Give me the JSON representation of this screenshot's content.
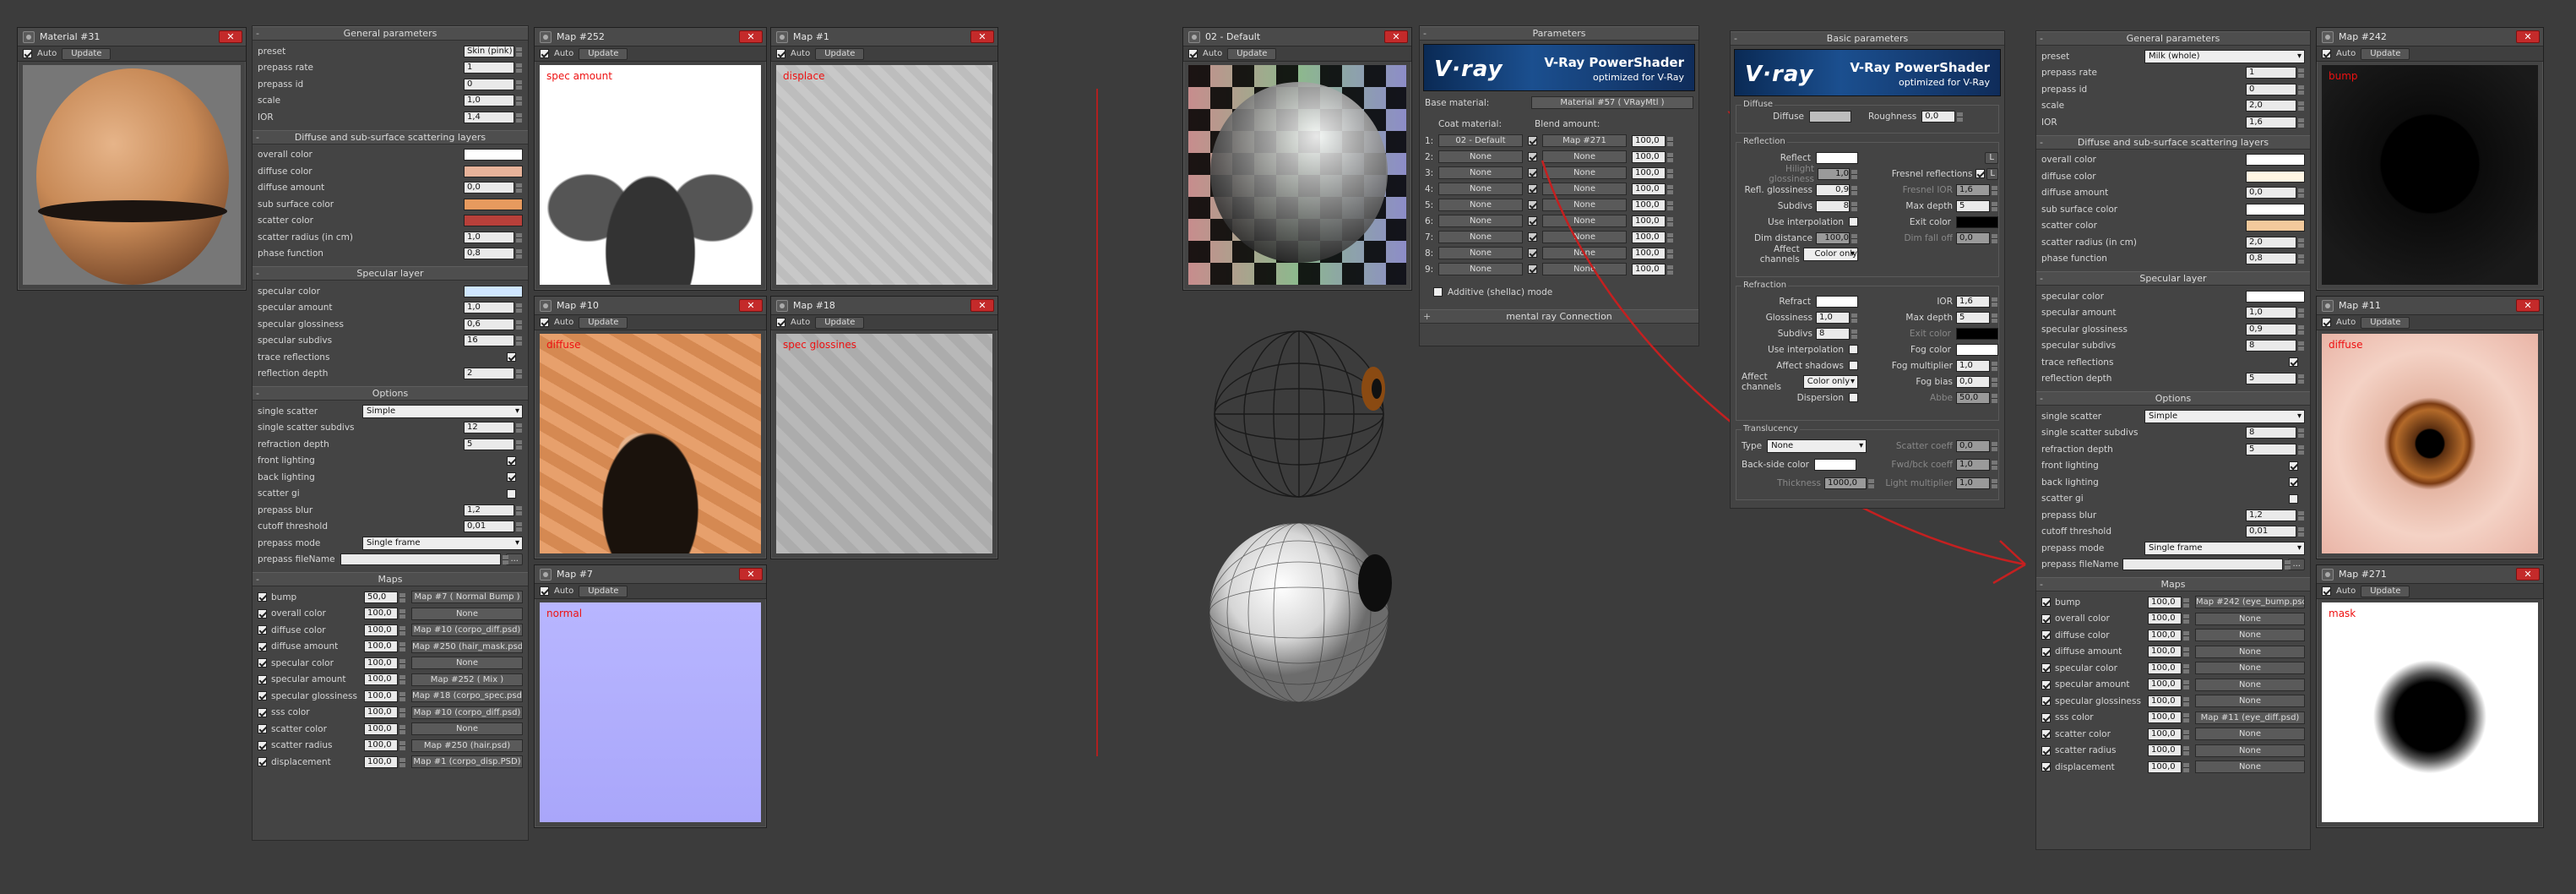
{
  "colors": {
    "accent_red": "#e11111",
    "vray_blue": "#1b4f8f",
    "bg": "#3c3c3c"
  },
  "left": {
    "material_win": {
      "title": "Material #31",
      "auto": "Auto",
      "update": "Update"
    },
    "general": {
      "header": "General parameters",
      "rows": [
        {
          "label": "preset",
          "value": "Skin (pink)"
        },
        {
          "label": "prepass rate",
          "value": "1"
        },
        {
          "label": "prepass id",
          "value": "0"
        },
        {
          "label": "scale",
          "value": "1,0"
        },
        {
          "label": "IOR",
          "value": "1,4"
        }
      ]
    },
    "diffuse": {
      "header": "Diffuse and sub-surface scattering layers",
      "rows": [
        {
          "label": "overall color",
          "color": "#ffffff"
        },
        {
          "label": "diffuse color",
          "color": "#e8b39a"
        },
        {
          "label": "diffuse amount",
          "value": "0,0"
        },
        {
          "label": "sub surface color",
          "color": "#e79a5e"
        },
        {
          "label": "scatter color",
          "color": "#b8403a"
        },
        {
          "label": "scatter radius (in cm)",
          "value": "1,0"
        },
        {
          "label": "phase function",
          "value": "0,8"
        }
      ]
    },
    "specular": {
      "header": "Specular layer",
      "rows": [
        {
          "label": "specular color",
          "color": "#cfe6ff"
        },
        {
          "label": "specular amount",
          "value": "1,0"
        },
        {
          "label": "specular glossiness",
          "value": "0,6"
        },
        {
          "label": "specular subdivs",
          "value": "16"
        },
        {
          "label": "trace reflections",
          "check": true
        },
        {
          "label": "reflection depth",
          "value": "2"
        }
      ]
    },
    "options": {
      "header": "Options",
      "rows": [
        {
          "label": "single scatter",
          "dropdown": "Simple"
        },
        {
          "label": "single scatter subdivs",
          "value": "12"
        },
        {
          "label": "refraction depth",
          "value": "5"
        },
        {
          "label": "front lighting",
          "check": true
        },
        {
          "label": "back lighting",
          "check": true
        },
        {
          "label": "scatter gi",
          "check": false
        },
        {
          "label": "prepass blur",
          "value": "1,2"
        },
        {
          "label": "cutoff threshold",
          "value": "0,01"
        },
        {
          "label": "prepass mode",
          "dropdown": "Single frame"
        },
        {
          "label": "prepass fileName",
          "value": ""
        }
      ]
    },
    "maps": {
      "header": "Maps",
      "rows": [
        {
          "label": "bump",
          "amount": "50,0",
          "map": "Map #7  ( Normal Bump )",
          "check": true
        },
        {
          "label": "overall color",
          "amount": "100,0",
          "map": "None",
          "check": true
        },
        {
          "label": "diffuse color",
          "amount": "100,0",
          "map": "Map #10 (corpo_diff.psd)",
          "check": true
        },
        {
          "label": "diffuse amount",
          "amount": "100,0",
          "map": "Map #250 (hair_mask.psd)",
          "check": true
        },
        {
          "label": "specular color",
          "amount": "100,0",
          "map": "None",
          "check": true
        },
        {
          "label": "specular amount",
          "amount": "100,0",
          "map": "Map #252  ( Mix )",
          "check": true
        },
        {
          "label": "specular glossiness",
          "amount": "100,0",
          "map": "Map #18 (corpo_spec.psd)",
          "check": true
        },
        {
          "label": "sss color",
          "amount": "100,0",
          "map": "Map #10 (corpo_diff.psd)",
          "check": true
        },
        {
          "label": "scatter color",
          "amount": "100,0",
          "map": "None",
          "check": true
        },
        {
          "label": "scatter radius",
          "amount": "100,0",
          "map": "Map #250 (hair.psd)",
          "check": true
        },
        {
          "label": "displacement",
          "amount": "100,0",
          "map": "Map #1 (corpo_disp.PSD)",
          "check": true
        }
      ]
    },
    "map_windows": [
      {
        "title": "Map #252",
        "label": "spec amount"
      },
      {
        "title": "Map #1",
        "label": "displace"
      },
      {
        "title": "Map #10",
        "label": "diffuse"
      },
      {
        "title": "Map #18",
        "label": "spec glossines"
      },
      {
        "title": "Map #7",
        "label": "normal"
      }
    ]
  },
  "center": {
    "default_win": {
      "title": "02 - Default",
      "auto": "Auto",
      "update": "Update"
    },
    "params": {
      "header": "Parameters",
      "banner_logo": "V·ray",
      "banner_title": "V-Ray PowerShader",
      "banner_sub": "optimized for V-Ray",
      "base_label": "Base material:",
      "base_value": "Material #57  ( VRayMtl )",
      "coat_label": "Coat material:",
      "blend_label": "Blend amount:",
      "coats": [
        {
          "n": "1:",
          "coat": "02 - Default",
          "blend": "Map #271",
          "amt": "100,0"
        },
        {
          "n": "2:",
          "coat": "None",
          "blend": "None",
          "amt": "100,0"
        },
        {
          "n": "3:",
          "coat": "None",
          "blend": "None",
          "amt": "100,0"
        },
        {
          "n": "4:",
          "coat": "None",
          "blend": "None",
          "amt": "100,0"
        },
        {
          "n": "5:",
          "coat": "None",
          "blend": "None",
          "amt": "100,0"
        },
        {
          "n": "6:",
          "coat": "None",
          "blend": "None",
          "amt": "100,0"
        },
        {
          "n": "7:",
          "coat": "None",
          "blend": "None",
          "amt": "100,0"
        },
        {
          "n": "8:",
          "coat": "None",
          "blend": "None",
          "amt": "100,0"
        },
        {
          "n": "9:",
          "coat": "None",
          "blend": "None",
          "amt": "100,0"
        }
      ],
      "additive": "Additive (shellac) mode",
      "mental_ray": "mental ray Connection"
    }
  },
  "basic": {
    "header": "Basic parameters",
    "banner_logo": "V·ray",
    "banner_title": "V-Ray PowerShader",
    "banner_sub": "optimized for V-Ray",
    "diffuse": {
      "group": "Diffuse",
      "label": "Diffuse",
      "rough_label": "Roughness",
      "rough": "0,0"
    },
    "reflection": {
      "group": "Reflection",
      "reflect": "Reflect",
      "hgloss": "Hilight glossiness",
      "hgloss_val": "1,0",
      "rgloss": "Refl. glossiness",
      "rgloss_val": "0,9",
      "subdivs": "Subdivs",
      "subdivs_val": "8",
      "interp": "Use interpolation",
      "dim": "Dim distance",
      "dim_val": "100,0",
      "affect": "Affect channels",
      "affect_val": "Color only",
      "fresnel": "Fresnel reflections",
      "fior": "Fresnel IOR",
      "fior_val": "1,6",
      "maxd": "Max depth",
      "maxd_val": "5",
      "exit": "Exit color",
      "dimf": "Dim fall off",
      "dimf_val": "0,0",
      "L": "L"
    },
    "refraction": {
      "group": "Refraction",
      "refract": "Refract",
      "ior": "IOR",
      "ior_val": "1,6",
      "gloss": "Glossiness",
      "gloss_val": "1,0",
      "maxd": "Max depth",
      "maxd_val": "5",
      "subdivs": "Subdivs",
      "subdivs_val": "8",
      "exit": "Exit color",
      "interp": "Use interpolation",
      "fog": "Fog color",
      "shadows": "Affect shadows",
      "fogm": "Fog multiplier",
      "fogm_val": "1,0",
      "affect": "Affect channels",
      "affect_val": "Color only",
      "fogb": "Fog bias",
      "fogb_val": "0,0",
      "disp": "Dispersion",
      "abbe": "Abbe",
      "abbe_val": "50,0"
    },
    "translucency": {
      "group": "Translucency",
      "type": "Type",
      "type_val": "None",
      "sc": "Scatter coeff",
      "sc_val": "0,0",
      "back": "Back-side color",
      "fwd": "Fwd/bck coeff",
      "fwd_val": "1,0",
      "thick": "Thickness",
      "thick_val": "1000,0",
      "lm": "Light multiplier",
      "lm_val": "1,0"
    }
  },
  "right": {
    "general": {
      "header": "General parameters",
      "rows": [
        {
          "label": "preset",
          "dropdown": "Milk (whole)"
        },
        {
          "label": "prepass rate",
          "value": "1"
        },
        {
          "label": "prepass id",
          "value": "0"
        },
        {
          "label": "scale",
          "value": "2,0"
        },
        {
          "label": "IOR",
          "value": "1,6"
        }
      ]
    },
    "diffuse": {
      "header": "Diffuse and sub-surface scattering layers",
      "rows": [
        {
          "label": "overall color",
          "color": "#ffffff"
        },
        {
          "label": "diffuse color",
          "color": "#fff6e4"
        },
        {
          "label": "diffuse amount",
          "value": "0,0"
        },
        {
          "label": "sub surface color",
          "color": "#ffffff"
        },
        {
          "label": "scatter color",
          "color": "#f3c99c"
        },
        {
          "label": "scatter radius (in cm)",
          "value": "2,0"
        },
        {
          "label": "phase function",
          "value": "0,8"
        }
      ]
    },
    "specular": {
      "header": "Specular layer",
      "rows": [
        {
          "label": "specular color",
          "color": "#ffffff"
        },
        {
          "label": "specular amount",
          "value": "1,0"
        },
        {
          "label": "specular glossiness",
          "value": "0,9"
        },
        {
          "label": "specular subdivs",
          "value": "8"
        },
        {
          "label": "trace reflections",
          "check": true
        },
        {
          "label": "reflection depth",
          "value": "5"
        }
      ]
    },
    "options": {
      "header": "Options",
      "rows": [
        {
          "label": "single scatter",
          "dropdown": "Simple"
        },
        {
          "label": "single scatter subdivs",
          "value": "8"
        },
        {
          "label": "refraction depth",
          "value": "5"
        },
        {
          "label": "front lighting",
          "check": true
        },
        {
          "label": "back lighting",
          "check": true
        },
        {
          "label": "scatter gi",
          "check": false
        },
        {
          "label": "prepass blur",
          "value": "1,2"
        },
        {
          "label": "cutoff threshold",
          "value": "0,01"
        },
        {
          "label": "prepass mode",
          "dropdown": "Single frame"
        },
        {
          "label": "prepass fileName",
          "value": ""
        }
      ]
    },
    "maps": {
      "header": "Maps",
      "rows": [
        {
          "label": "bump",
          "amount": "100,0",
          "map": "Map #242 (eye_bump.psd)",
          "check": true
        },
        {
          "label": "overall color",
          "amount": "100,0",
          "map": "None",
          "check": true
        },
        {
          "label": "diffuse color",
          "amount": "100,0",
          "map": "None",
          "check": true
        },
        {
          "label": "diffuse amount",
          "amount": "100,0",
          "map": "None",
          "check": true
        },
        {
          "label": "specular color",
          "amount": "100,0",
          "map": "None",
          "check": true
        },
        {
          "label": "specular amount",
          "amount": "100,0",
          "map": "None",
          "check": true
        },
        {
          "label": "specular glossiness",
          "amount": "100,0",
          "map": "None",
          "check": true
        },
        {
          "label": "sss color",
          "amount": "100,0",
          "map": "Map #11 (eye_diff.psd)",
          "check": true
        },
        {
          "label": "scatter color",
          "amount": "100,0",
          "map": "None",
          "check": true
        },
        {
          "label": "scatter radius",
          "amount": "100,0",
          "map": "None",
          "check": true
        },
        {
          "label": "displacement",
          "amount": "100,0",
          "map": "None",
          "check": true
        }
      ]
    },
    "map_windows": [
      {
        "title": "Map #242",
        "label": "bump"
      },
      {
        "title": "Map #11",
        "label": "diffuse"
      },
      {
        "title": "Map #271",
        "label": "mask"
      }
    ]
  }
}
